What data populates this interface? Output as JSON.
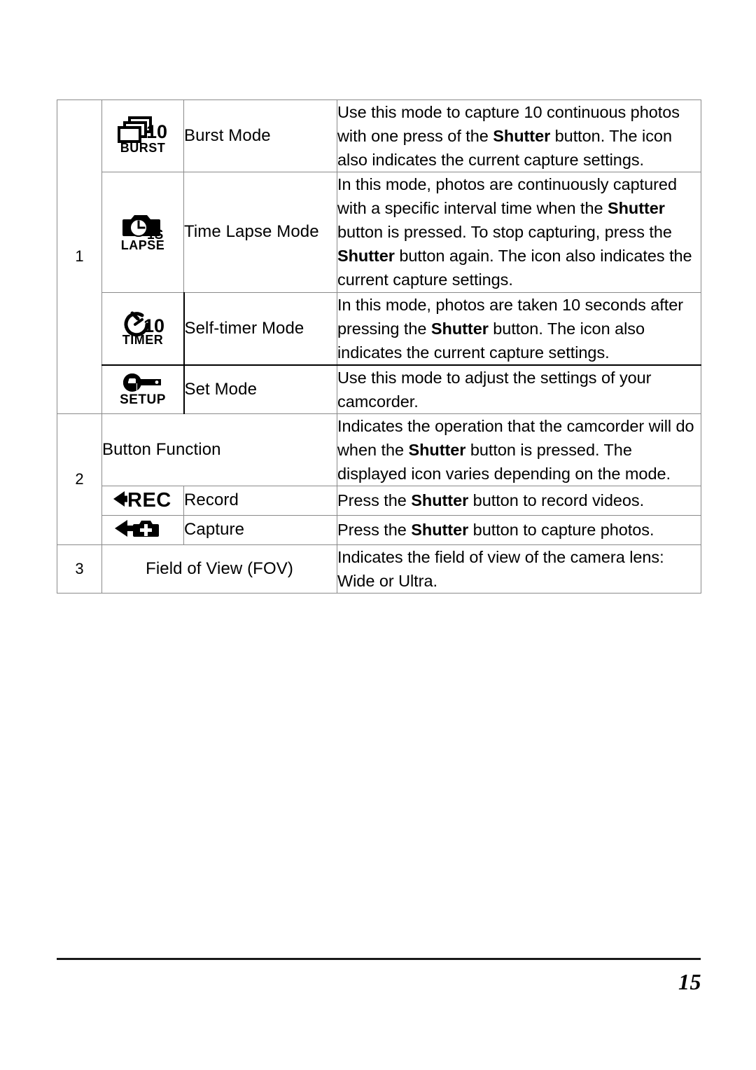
{
  "document": {
    "page_number": "15"
  },
  "table": {
    "rows": [
      {
        "number": "1",
        "items": [
          {
            "icon": "burst-mode-icon",
            "icon_text": {
              "count": "10",
              "caption": "BURST"
            },
            "label": "Burst Mode",
            "description_parts": [
              {
                "text": "Use this mode to capture 10 continuous photos with one press of the ",
                "bold": false
              },
              {
                "text": "Shutter",
                "bold": true
              },
              {
                "text": " button. The icon also indicates the current capture settings.",
                "bold": false
              }
            ]
          },
          {
            "icon": "time-lapse-icon",
            "icon_text": {
              "count": "1S",
              "caption": "LAPSE"
            },
            "label": "Time Lapse Mode",
            "description_parts": [
              {
                "text": "In this mode, photos are continuously captured with a specific interval time when the ",
                "bold": false
              },
              {
                "text": "Shutter",
                "bold": true
              },
              {
                "text": " button is pressed. To stop capturing, press the ",
                "bold": false
              },
              {
                "text": "Shutter",
                "bold": true
              },
              {
                "text": " button again. The icon also indicates the current capture settings.",
                "bold": false
              }
            ]
          },
          {
            "icon": "self-timer-icon",
            "icon_text": {
              "count": "10",
              "caption": "TIMER"
            },
            "label": "Self-timer Mode",
            "description_parts": [
              {
                "text": "In this mode, photos are taken 10 seconds after pressing the ",
                "bold": false
              },
              {
                "text": "Shutter",
                "bold": true
              },
              {
                "text": " button. The icon also indicates the current capture settings.",
                "bold": false
              }
            ]
          },
          {
            "icon": "setup-wrench-icon",
            "icon_text": {
              "count": "",
              "caption": "SETUP"
            },
            "label": "Set Mode",
            "description_parts": [
              {
                "text": "Use this mode to adjust the settings of your camcorder.",
                "bold": false
              }
            ]
          }
        ]
      },
      {
        "number": "2",
        "items": [
          {
            "icon": "",
            "label": "Button Function",
            "label_spans_icon_column": true,
            "description_parts": [
              {
                "text": "Indicates the operation that the camcorder will do when the ",
                "bold": false
              },
              {
                "text": "Shutter",
                "bold": true
              },
              {
                "text": " button is pressed. The displayed icon varies depending on the mode.",
                "bold": false
              }
            ]
          },
          {
            "icon": "record-arrow-icon",
            "icon_text": {
              "count": "",
              "caption": "REC"
            },
            "label": "Record",
            "description_parts": [
              {
                "text": "Press the ",
                "bold": false
              },
              {
                "text": "Shutter",
                "bold": true
              },
              {
                "text": " button to record videos.",
                "bold": false
              }
            ]
          },
          {
            "icon": "capture-camera-arrow-icon",
            "icon_text": {
              "count": "",
              "caption": ""
            },
            "label": "Capture",
            "description_parts": [
              {
                "text": "Press the ",
                "bold": false
              },
              {
                "text": "Shutter",
                "bold": true
              },
              {
                "text": " button to capture photos.",
                "bold": false
              }
            ]
          }
        ]
      },
      {
        "number": "3",
        "items": [
          {
            "icon": "",
            "label": "Field of View (FOV)",
            "label_spans_icon_column": true,
            "description_parts": [
              {
                "text": "Indicates the field of view of the camera lens: Wide or Ultra.",
                "bold": false
              }
            ]
          }
        ]
      }
    ]
  }
}
